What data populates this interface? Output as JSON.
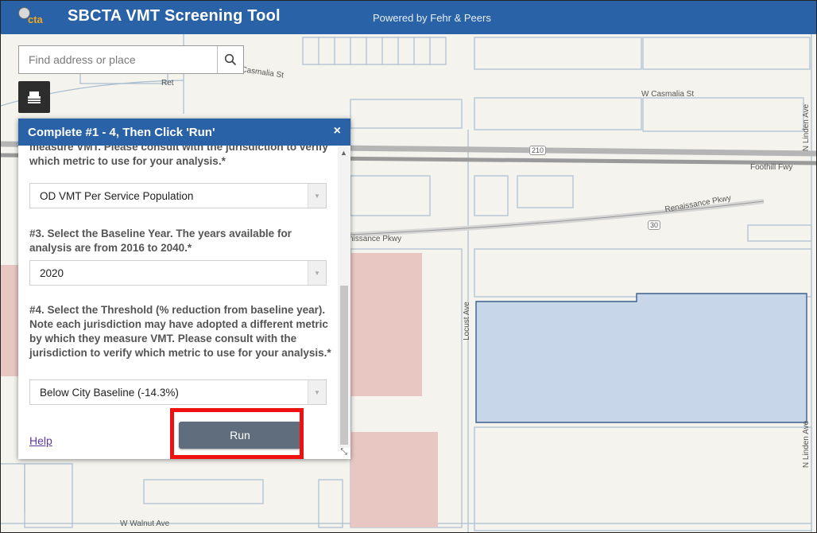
{
  "header": {
    "logo_text": "cta",
    "title": "SBCTA VMT Screening Tool",
    "powered_by": "Powered by Fehr & Peers"
  },
  "search": {
    "placeholder": "Find address or place",
    "value": "",
    "icon": "search-icon"
  },
  "basemap": {
    "icon": "basemap-gallery-icon"
  },
  "map_labels": {
    "w_casmalia_left": "W Casmalia St",
    "w_casmalia_right": "W Casmalia St",
    "foothill": "Foothill Fwy",
    "route_210": "210",
    "renaissance_right": "Renaissance Pkwy",
    "renaissance_left": "nissance Pkwy",
    "route_30": "30",
    "locust": "Locust Ave",
    "n_linden_top": "N Linden Ave",
    "n_linden_bottom": "N Linden Ave",
    "w_walnut": "W Walnut Ave",
    "poi": "Ret"
  },
  "panel": {
    "title": "Complete #1 - 4, Then Click 'Run'",
    "close_label": "×",
    "q2_text": "measure VMT. Please consult with the jurisdiction to verify which metric to use for your analysis.*",
    "q2_value": "OD VMT Per Service Population",
    "q3_text": "#3. Select the Baseline Year. The years available for analysis are from 2016 to 2040.*",
    "q3_value": "2020",
    "q4_text": "#4. Select the Threshold (% reduction from baseline year). Note each jurisdiction may have adopted a different metric by which they measure VMT. Please consult with the jurisdiction to verify which metric to use for your analysis.*",
    "q4_value": "Below City Baseline (-14.3%)",
    "help_label": "Help",
    "run_label": "Run"
  },
  "colors": {
    "header_blue": "#2a62a8",
    "highlight_red": "#ee1111",
    "parcel_blue": "#c7d6e8"
  }
}
